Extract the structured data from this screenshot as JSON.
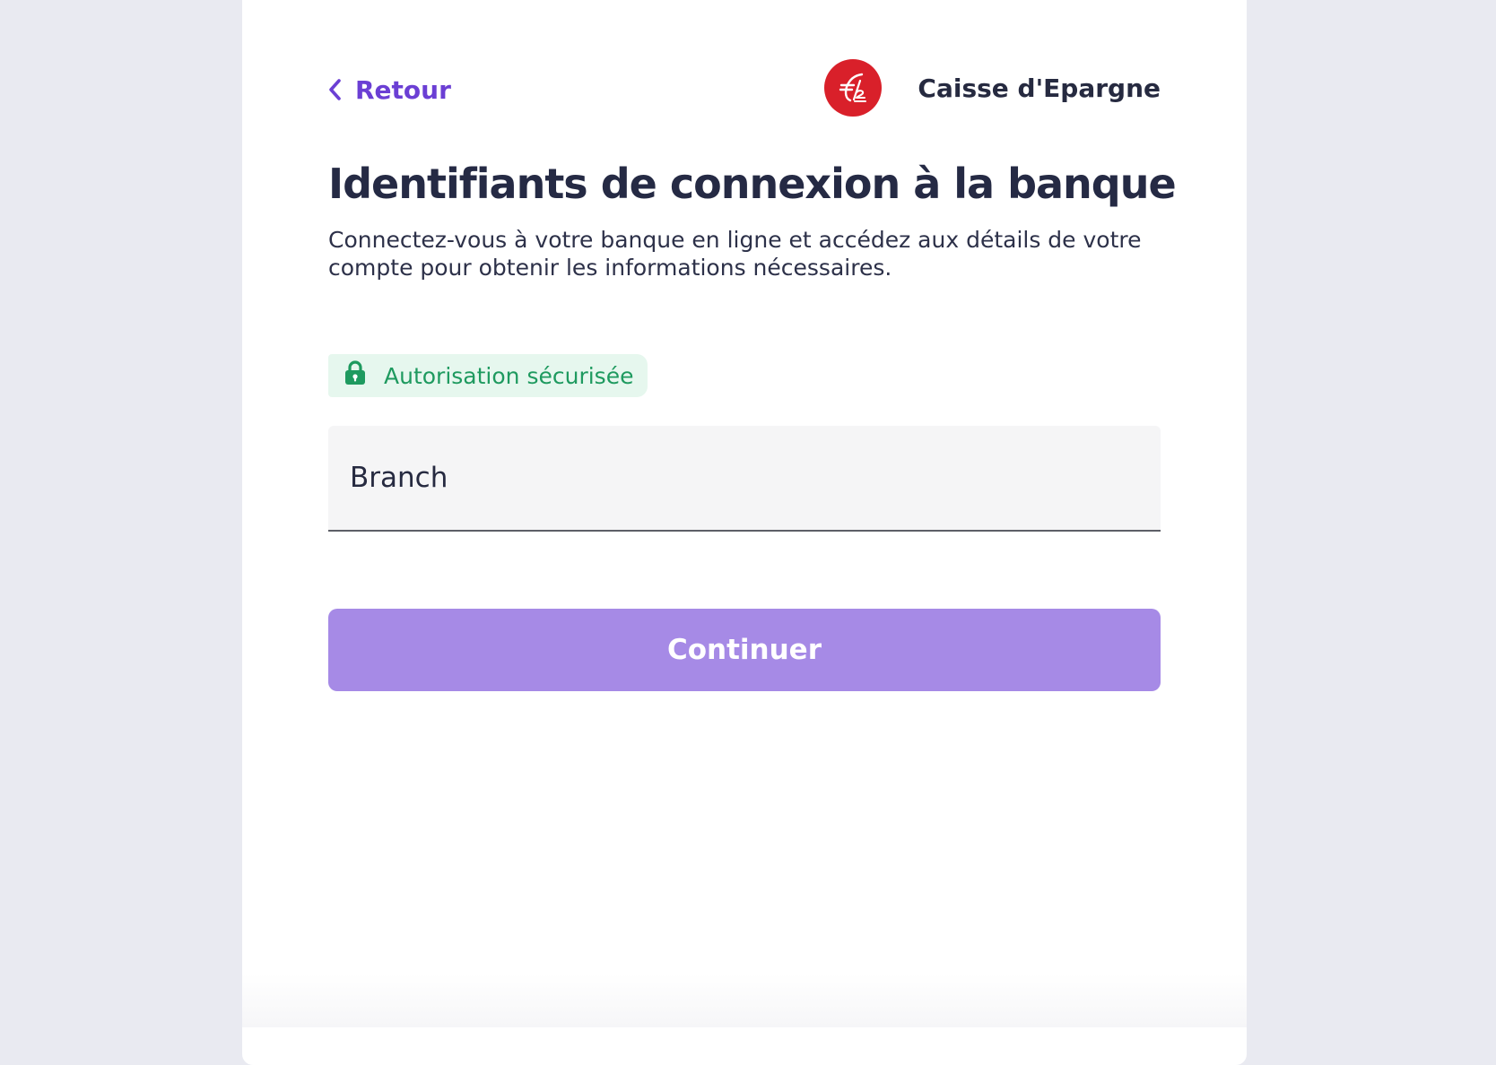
{
  "header": {
    "back_label": "Retour",
    "bank_name": "Caisse d'Epargne"
  },
  "main": {
    "title": "Identifiants de connexion à la banque",
    "subtitle": "Connectez-vous à votre banque en ligne et accédez aux détails de votre compte pour obtenir les informations nécessaires.",
    "secure_badge": "Autorisation sécurisée",
    "branch_field": {
      "placeholder": "Branch",
      "value": ""
    },
    "continue_label": "Continuer"
  },
  "icons": {
    "back": "chevron-left-icon",
    "bank_logo": "caisse-epargne-logo",
    "secure": "lock-icon"
  },
  "colors": {
    "accent": "#6b3fd4",
    "button": "#a68ae6",
    "secure_text": "#1e9a5f",
    "secure_bg": "#e6f7ee",
    "bank_logo": "#d9202a",
    "page_bg": "#e9eaf1"
  }
}
